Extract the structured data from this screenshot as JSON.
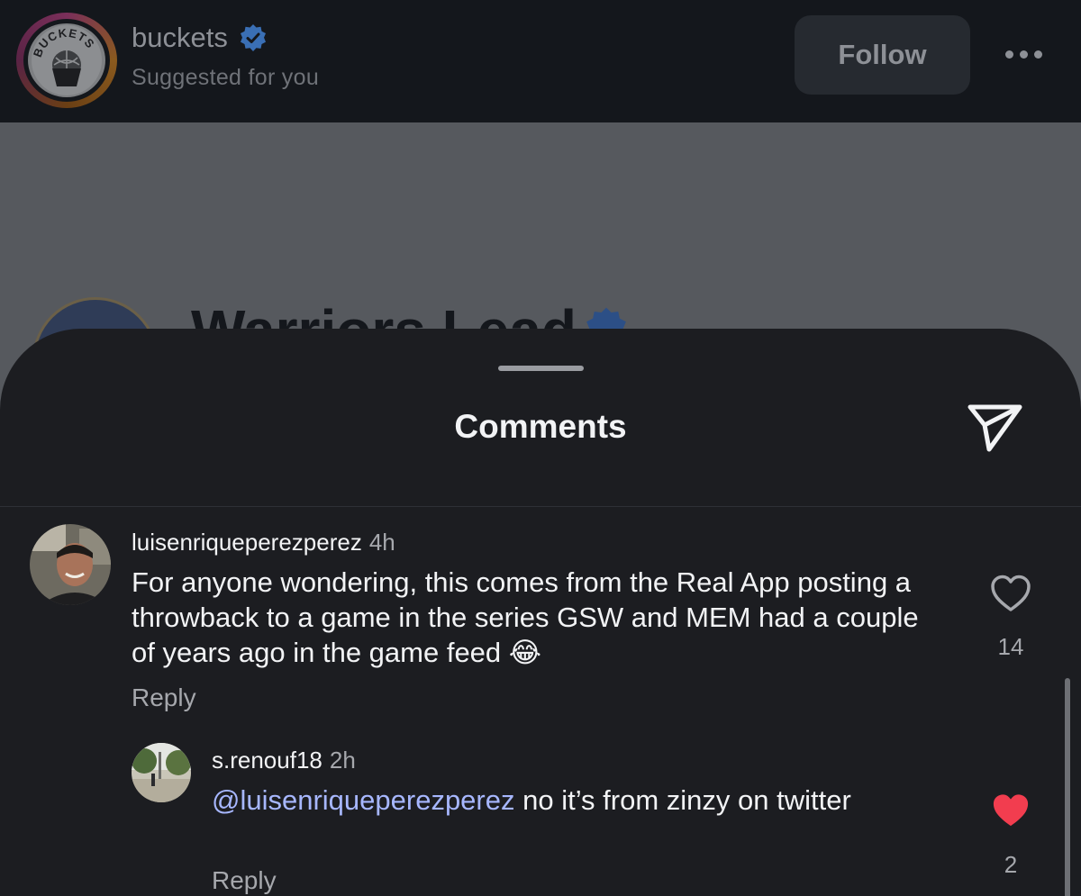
{
  "post": {
    "username": "buckets",
    "logo_text": "BUCKETS",
    "subtitle": "Suggested for you",
    "follow_label": "Follow",
    "underlying_title": "Warriors Lead"
  },
  "sheet": {
    "title": "Comments"
  },
  "comments": [
    {
      "username": "luisenriqueperezperez",
      "time": "4h",
      "text": "For anyone wondering, this comes from the Real App posting a throwback to a game in the series GSW and MEM had a couple of years ago in the game feed",
      "emoji": "😂",
      "reply_label": "Reply",
      "likes": "14",
      "liked": false
    },
    {
      "username": "s.renouf18",
      "time": "2h",
      "mention": "@luisenriqueperezperez",
      "text": " no it’s from zinzy on twitter",
      "reply_label": "Reply",
      "likes": "2",
      "liked": true
    }
  ],
  "colors": {
    "like_active": "#f23d4f",
    "mention": "#a7b7ff",
    "verified": "#3a7bd5"
  }
}
